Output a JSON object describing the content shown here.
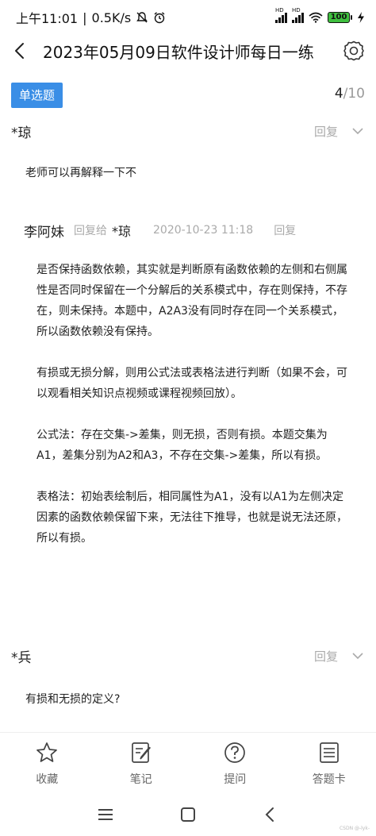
{
  "status": {
    "time": "上午11:01",
    "separator": "|",
    "speed": "0.5K/s",
    "battery": "100"
  },
  "header": {
    "title": "2023年05月09日软件设计师每日一练"
  },
  "question": {
    "type_label": "单选题",
    "current": "4",
    "total": "/10"
  },
  "comments": [
    {
      "user": "*琼",
      "reply_label": "回复",
      "text": "老师可以再解释一下不"
    },
    {
      "user": "*兵",
      "reply_label": "回复",
      "text": "有损和无损的定义?"
    }
  ],
  "reply": {
    "user": "李阿妹",
    "reply_to_label": "回复给",
    "target": "*琼",
    "time": "2020-10-23 11:18",
    "reply_label": "回复",
    "paragraphs": [
      "是否保持函数依赖，其实就是判断原有函数依赖的左侧和右侧属性是否同时保留在一个分解后的关系模式中，存在则保持，不存在，则未保持。本题中，A2A3没有同时存在同一个关系模式，所以函数依赖没有保持。",
      "有损或无损分解，则用公式法或表格法进行判断（如果不会，可以观看相关知识点视频或课程视频回放）。",
      "公式法：存在交集->差集，则无损，否则有损。本题交集为A1，差集分别为A2和A3，不存在交集->差集，所以有损。",
      "表格法：初始表绘制后，相同属性为A1，没有以A1为左侧决定因素的函数依赖保留下来，无法往下推导，也就是说无法还原，所以有损。"
    ]
  },
  "bottom_nav": [
    {
      "label": "收藏",
      "icon": "star-icon"
    },
    {
      "label": "笔记",
      "icon": "note-icon"
    },
    {
      "label": "提问",
      "icon": "question-icon"
    },
    {
      "label": "答题卡",
      "icon": "answer-card-icon"
    }
  ],
  "watermark": "CSDN @-lyk-",
  "colors": {
    "accent": "#3a8ee6",
    "muted": "#aaaaaa",
    "text": "#222222"
  }
}
